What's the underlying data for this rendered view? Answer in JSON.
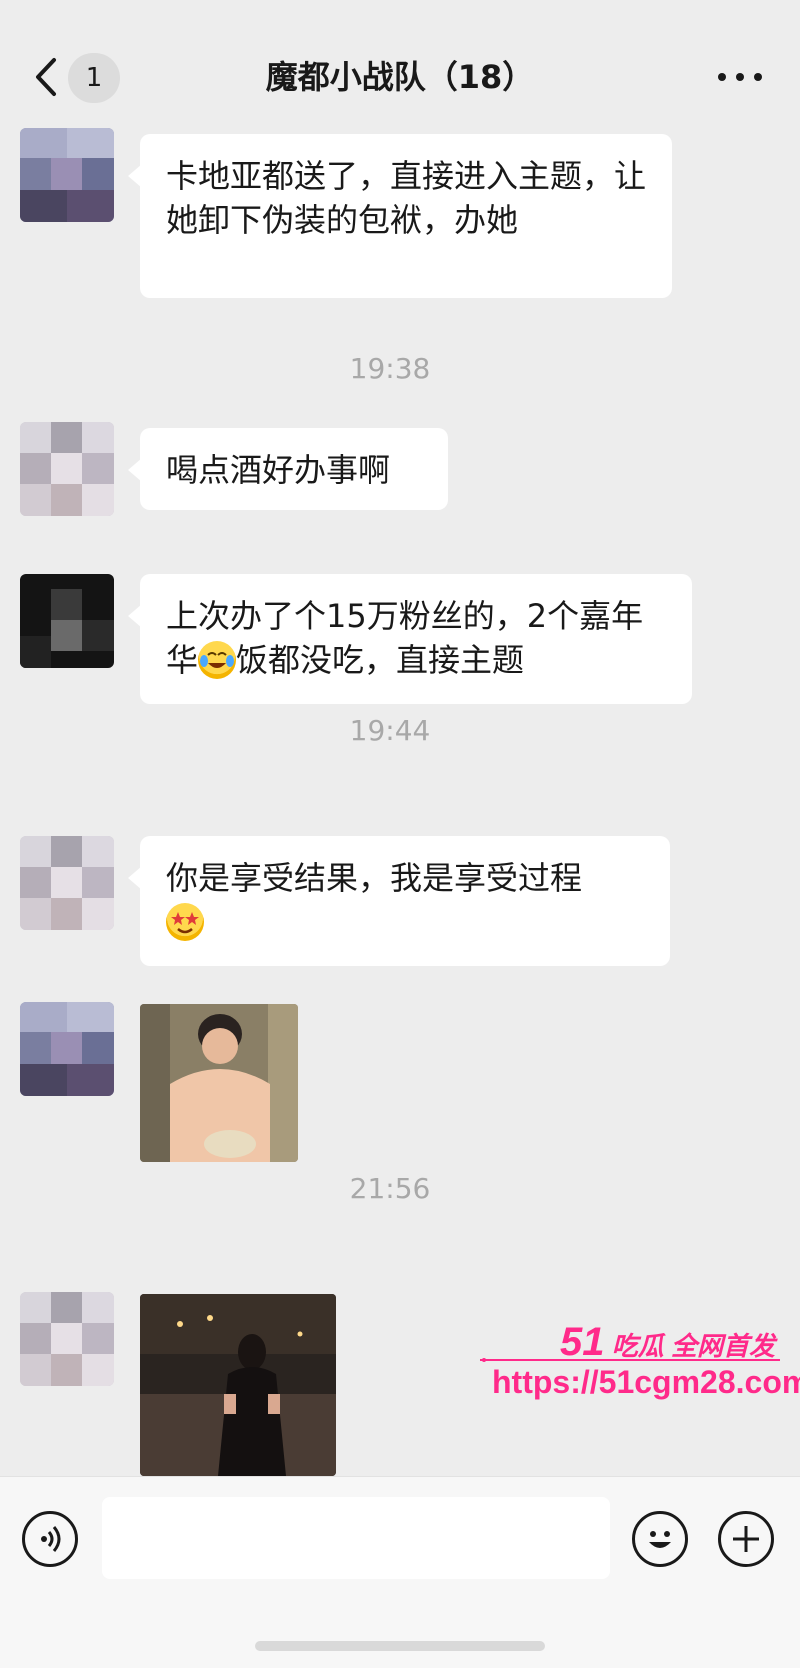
{
  "header": {
    "unread_count": "1",
    "title": "魔都小战队（18）"
  },
  "messages": [
    {
      "type": "text",
      "text": "卡地亚都送了，直接进入主题，让她卸下伪装的包袱，办她"
    },
    {
      "type": "time",
      "text": "19:38"
    },
    {
      "type": "text",
      "text": "喝点酒好办事啊"
    },
    {
      "type": "text",
      "text_a": "上次办了个15万粉丝的，2个嘉年华",
      "text_b": "饭都没吃，直接主题",
      "emoji": "tears-of-joy"
    },
    {
      "type": "time",
      "text": "19:44"
    },
    {
      "type": "text",
      "text": "你是享受结果，我是享受过程",
      "emoji": "star-struck"
    },
    {
      "type": "image",
      "icon": "meme-photo"
    },
    {
      "type": "time",
      "text": "21:56"
    },
    {
      "type": "image",
      "icon": "night-street-photo"
    }
  ],
  "input": {
    "placeholder": ""
  },
  "watermark": {
    "num": "51",
    "brand": "吃瓜 全网首发",
    "url": "https://51cgm28.com",
    "color": "#ff2a8a"
  },
  "colors": {
    "background": "#ededed",
    "bubble": "#ffffff",
    "time": "#a8a8a8"
  }
}
